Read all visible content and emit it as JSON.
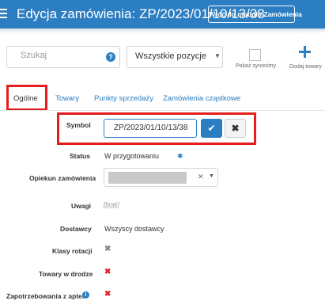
{
  "header": {
    "title": "Edycja zamówienia: ZP/2023/01/10/13/38",
    "back_button": "Wróć do modułu Zamówienia"
  },
  "toolbar": {
    "search_placeholder": "Szukaj",
    "help_label": "?",
    "positions_selected": "Wszystkie pozycje",
    "synonyms_label": "Pokaż synonimy",
    "add_products_label": "Dodaj towary"
  },
  "tabs": [
    {
      "label": "Ogólne",
      "active": true
    },
    {
      "label": "Towary"
    },
    {
      "label": "Punkty sprzedaży"
    },
    {
      "label": "Zamówienia cząstkowe"
    }
  ],
  "form": {
    "symbol": {
      "label": "Symbol",
      "value": "ZP/2023/01/10/13/38"
    },
    "status": {
      "label": "Status",
      "value": "W przygotowaniu"
    },
    "owner": {
      "label": "Opiekun zamówienia"
    },
    "notes": {
      "label": "Uwagi",
      "value": "[brak]"
    },
    "suppliers": {
      "label": "Dostawcy",
      "value": "Wszyscy dostawcy"
    },
    "rotation": {
      "label": "Klasy rotacji"
    },
    "in_transit": {
      "label": "Towary w drodze"
    },
    "pharmacy_demand": {
      "label": "Zapotrzebowania z aptek"
    }
  },
  "colors": {
    "primary": "#2b7ec1",
    "highlight": "#e41d1d",
    "negative": "#d9262b"
  }
}
